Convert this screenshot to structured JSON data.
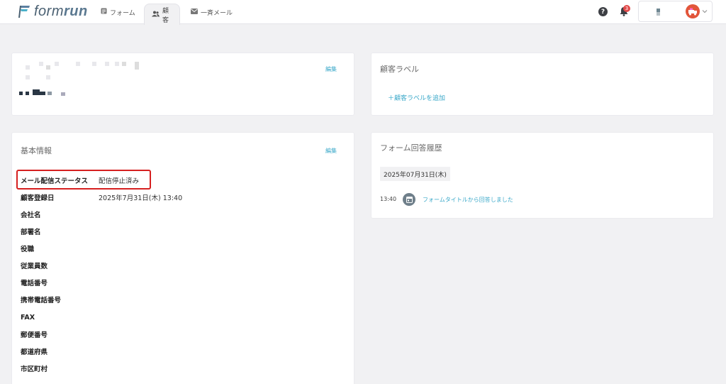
{
  "brand": {
    "logo_prefix": "form",
    "logo_suffix": "run"
  },
  "nav": {
    "tabs": [
      {
        "label": "フォーム",
        "icon": "form-list-icon",
        "active": false
      },
      {
        "label": "顧客",
        "icon": "users-icon",
        "active": true
      },
      {
        "label": "一斉メール",
        "icon": "mail-icon",
        "active": false
      }
    ]
  },
  "header": {
    "help_glyph": "?",
    "notification_count": "3"
  },
  "profile_card": {
    "edit_label": "編集"
  },
  "labels_card": {
    "title": "顧客ラベル",
    "add_label": "＋顧客ラベルを追加"
  },
  "basic_info": {
    "title": "基本情報",
    "edit_label": "編集",
    "fields": [
      {
        "label": "メール配信ステータス",
        "value": "配信停止済み"
      },
      {
        "label": "顧客登録日",
        "value": "2025年7月31日(木) 13:40"
      },
      {
        "label": "会社名",
        "value": ""
      },
      {
        "label": "部署名",
        "value": ""
      },
      {
        "label": "役職",
        "value": ""
      },
      {
        "label": "従業員数",
        "value": ""
      },
      {
        "label": "電話番号",
        "value": ""
      },
      {
        "label": "携帯電話番号",
        "value": ""
      },
      {
        "label": "FAX",
        "value": ""
      },
      {
        "label": "郵便番号",
        "value": ""
      },
      {
        "label": "都道府県",
        "value": ""
      },
      {
        "label": "市区町村",
        "value": ""
      }
    ]
  },
  "form_history": {
    "title": "フォーム回答履歴",
    "date": "2025年07月31日(木)",
    "entry_time": "13:40",
    "entry_text": "フォームタイトルから回答しました"
  },
  "colors": {
    "accent": "#3aa8c9",
    "highlight": "#d62020",
    "badge": "#e24a4a"
  }
}
